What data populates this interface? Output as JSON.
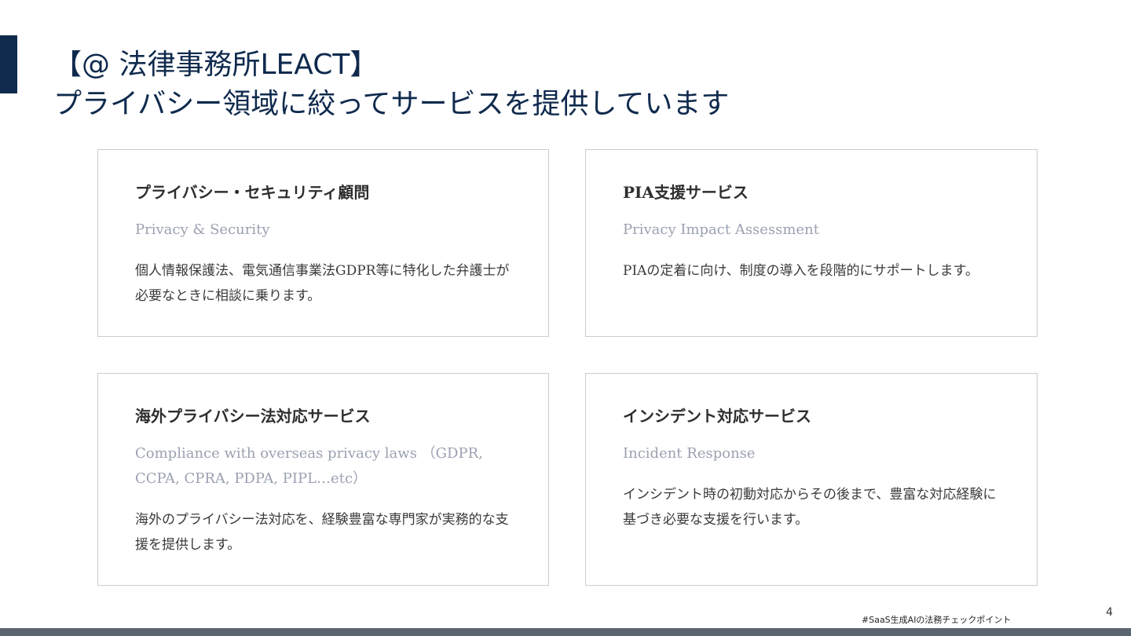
{
  "slide": {
    "title_line1": "【@ 法律事務所LEACT】",
    "title_line2": "プライバシー領域に絞ってサービスを提供しています"
  },
  "cards": [
    {
      "title": "プライバシー・セキュリティ顧問",
      "subtitle": "Privacy & Security",
      "description": "個人情報保護法、電気通信事業法GDPR等に特化した弁護士が必要なときに相談に乗ります。"
    },
    {
      "title": "PIA支援サービス",
      "subtitle": "Privacy Impact Assessment",
      "description": "PIAの定着に向け、制度の導入を段階的にサポートします。"
    },
    {
      "title": "海外プライバシー法対応サービス",
      "subtitle": "Compliance with overseas privacy laws （GDPR, CCPA, CPRA, PDPA, PIPL…etc）",
      "description": "海外のプライバシー法対応を、経験豊富な専門家が実務的な支援を提供します。"
    },
    {
      "title": "インシデント対応サービス",
      "subtitle": "Incident Response",
      "description": "インシデント時の初動対応からその後まで、豊富な対応経験に基づき必要な支援を行います。"
    }
  ],
  "footer": {
    "hashtag": "#SaaS生成AIの法務チェックポイント",
    "page_number": "4"
  },
  "colors": {
    "title": "#0f2a4d",
    "accent_bar": "#0f2a4d",
    "card_border": "#c9ccd2",
    "subtitle": "#9aa1b0",
    "footer_bar": "#5b6470"
  }
}
